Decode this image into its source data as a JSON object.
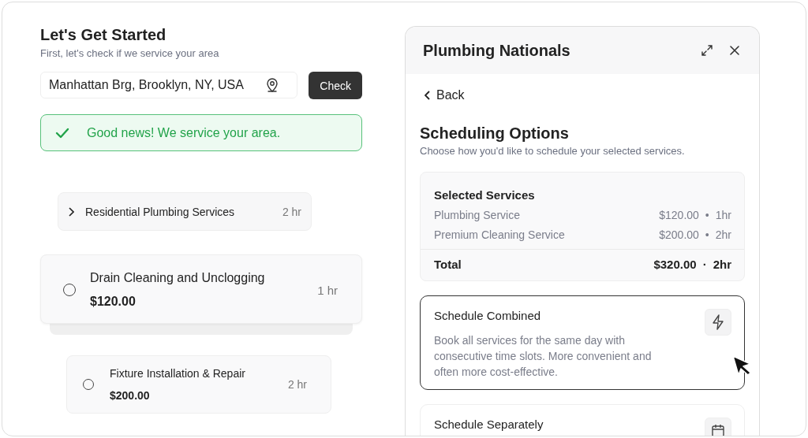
{
  "intro": {
    "title": "Let's Get Started",
    "subtitle": "First, let's check if we service your area"
  },
  "address": {
    "value": "Manhattan Brg, Brooklyn, NY, USA",
    "button": "Check"
  },
  "status": {
    "kind": "success",
    "message": "Good news! We service your area."
  },
  "services": [
    {
      "kind": "category",
      "name": "Residential Plumbing Services",
      "duration": "2 hr",
      "expanded": false
    },
    {
      "kind": "option",
      "name": "Drain Cleaning and Unclogging",
      "price": "$120.00",
      "duration": "1 hr",
      "selected": false,
      "raised": true
    },
    {
      "kind": "option",
      "name": "Fixture Installation & Repair",
      "price": "$200.00",
      "duration": "2 hr",
      "selected": false,
      "raised": false
    }
  ],
  "panel": {
    "title": "Plumbing Nationals",
    "back": "Back",
    "heading": "Scheduling Options",
    "subheading": "Choose how you'd like to schedule your selected services.",
    "summary": {
      "title": "Selected Services",
      "items": [
        {
          "name": "Plumbing Service",
          "price": "$120.00",
          "separator": "•",
          "duration": "1hr"
        },
        {
          "name": "Premium Cleaning Service",
          "price": "$200.00",
          "separator": "•",
          "duration": "2hr"
        }
      ],
      "total": {
        "label": "Total",
        "price": "$320.00",
        "separator": "·",
        "duration": "2hr"
      }
    },
    "options": [
      {
        "kind": "combined",
        "title": "Schedule Combined",
        "description": "Book all services for the same day with consecutive time slots. More convenient and often more cost-effective.",
        "selected": true
      },
      {
        "kind": "separate",
        "title": "Schedule Separately",
        "selected": false
      }
    ]
  }
}
